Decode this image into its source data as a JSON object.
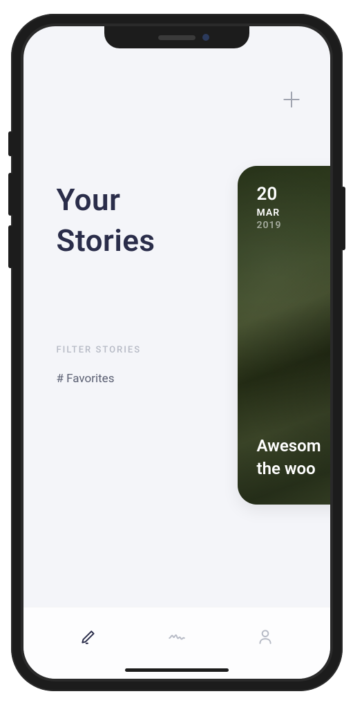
{
  "header": {
    "add_icon": "plus-icon"
  },
  "title": {
    "line1": "Your",
    "line2": "Stories"
  },
  "filter": {
    "label": "FILTER STORIES",
    "value": "# Favorites"
  },
  "card": {
    "day": "20",
    "month": "MAR",
    "year": "2019",
    "title_line1": "Awesom",
    "title_line2": "the woo"
  },
  "tabs": {
    "write": "pencil-icon",
    "activity": "activity-icon",
    "profile": "profile-icon"
  }
}
